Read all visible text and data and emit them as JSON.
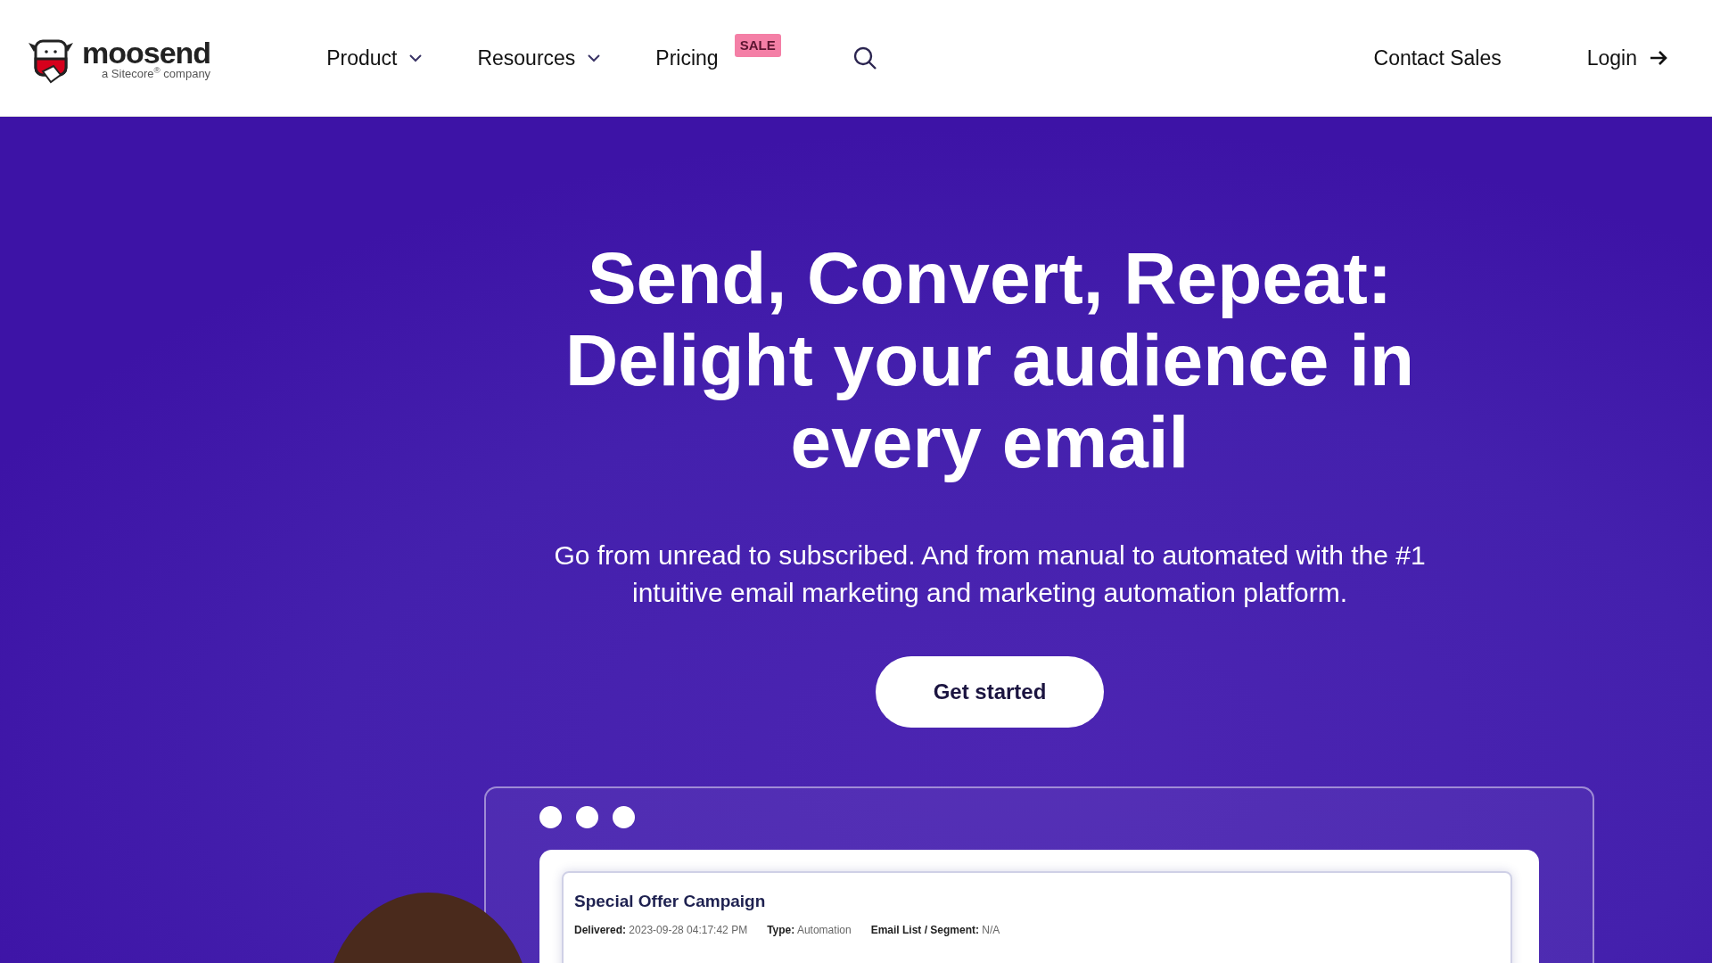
{
  "header": {
    "logo": {
      "name": "moosend",
      "tagline": "a Sitecore$^{®}$ company"
    },
    "nav": [
      {
        "label": "Product",
        "has_dropdown": true
      },
      {
        "label": "Resources",
        "has_dropdown": true
      },
      {
        "label": "Pricing",
        "has_dropdown": false,
        "badge": "SALE"
      }
    ],
    "search": true,
    "actions": [
      {
        "label": "Contact Sales",
        "kind": "link"
      },
      {
        "label": "Login",
        "kind": "arrow-link"
      }
    ]
  },
  "hero": {
    "headline": "Send, Convert, Repeat: Delight your audience in every email",
    "subtitle": "Go from unread to subscribed. And from manual to automated with the #1 intuitive email marketing and marketing automation platform.",
    "cta": "Get started",
    "preview": {
      "title": "Special Offer Campaign",
      "fields": [
        {
          "label": "Delivered:",
          "value": "2023-09-28 04:17:42 PM"
        },
        {
          "label": "Type:",
          "value": "Automation"
        },
        {
          "label": "Email List / Segment:",
          "value": "N/A"
        }
      ]
    }
  }
}
